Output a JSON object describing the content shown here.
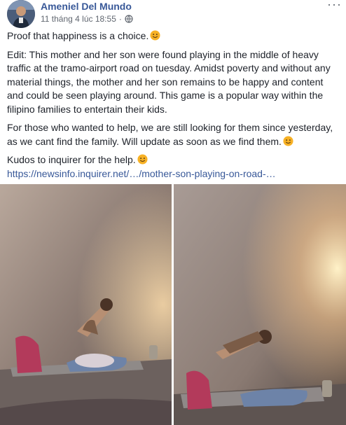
{
  "post": {
    "author": "Ameniel Del Mundo",
    "timestamp": "11 tháng 4 lúc 18:55",
    "more_label": "···",
    "paragraphs": [
      "Proof that happiness is a choice.",
      "Edit: This mother and her son were found playing in the middle of heavy traffic at the tramo-airport road on tuesday. Amidst poverty and without any material things, the mother and her son remains to be happy and content and could be seen playing around. This game is a popular way within the filipino families to entertain their kids.",
      "For those who wanted to help, we are still looking for them since yesterday, as we cant find the family. Will update as soon as we find them.",
      "Kudos to inquirer for the help."
    ],
    "link": "https://newsinfo.inquirer.net/…/mother-son-playing-on-road-…"
  },
  "icons": {
    "privacy": "globe-icon",
    "emoji": "smiley-emoji-icon",
    "more": "more-options-icon"
  },
  "colors": {
    "link": "#385898",
    "text": "#1d2129",
    "meta": "#616770",
    "emoji": "#f7b125"
  }
}
